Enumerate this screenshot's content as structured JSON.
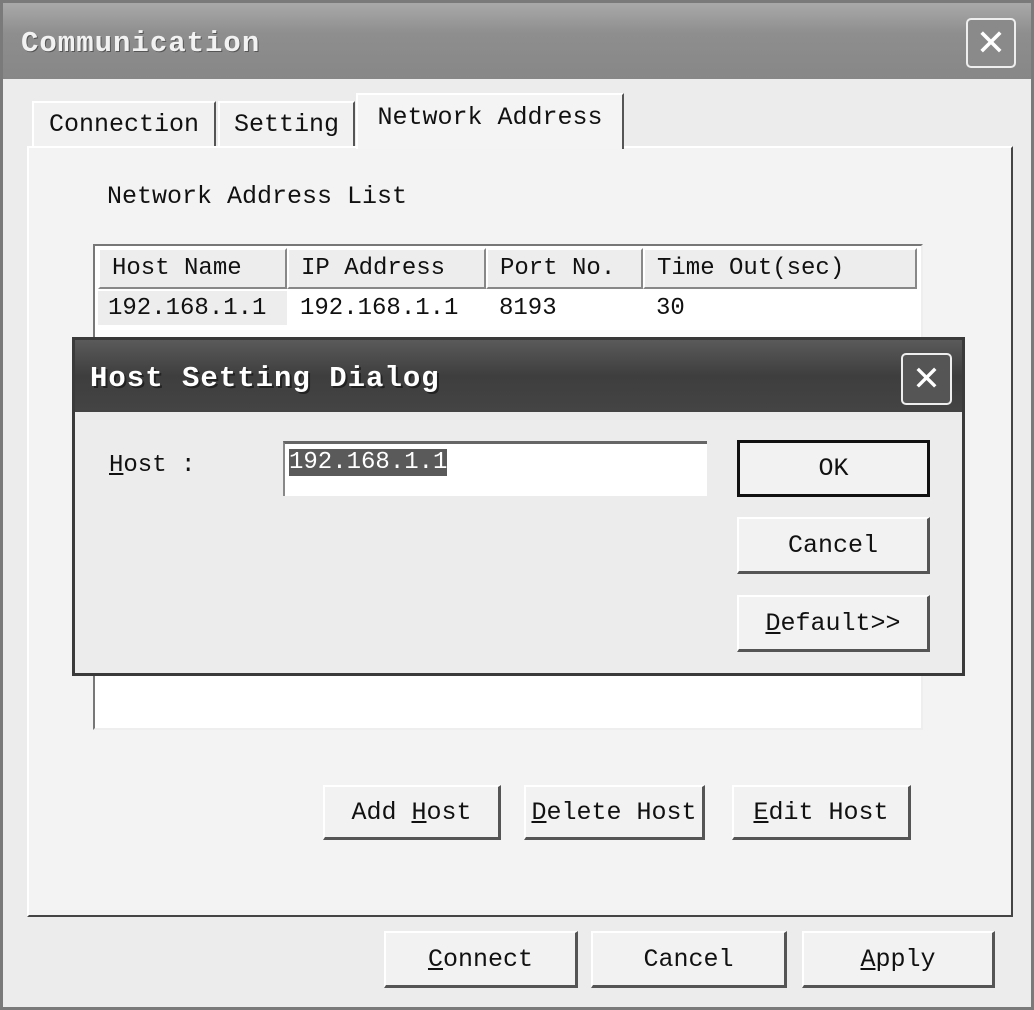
{
  "window": {
    "title": "Communication",
    "close_icon": "close-icon"
  },
  "tabs": [
    {
      "label": "Connection"
    },
    {
      "label": "Setting"
    },
    {
      "label": "Network Address",
      "active": true
    }
  ],
  "panel": {
    "section_label": "Network Address List",
    "columns": [
      "Host Name",
      "IP Address",
      "Port No.",
      "Time Out(sec)"
    ],
    "rows": [
      {
        "host_name": "192.168.1.1",
        "ip": "192.168.1.1",
        "port": "8193",
        "timeout": "30"
      }
    ],
    "buttons": [
      {
        "label": "Add Host",
        "mnemonic": "H"
      },
      {
        "label": "Delete Host",
        "mnemonic": "D"
      },
      {
        "label": "Edit Host",
        "mnemonic": "E"
      }
    ]
  },
  "footer": {
    "buttons": [
      {
        "label": "Connect",
        "mnemonic": "C"
      },
      {
        "label": "Cancel"
      },
      {
        "label": "Apply",
        "mnemonic": "A"
      }
    ]
  },
  "dialog": {
    "title": "Host Setting Dialog",
    "host_label": "Host :",
    "host_mnemonic": "H",
    "host_value": "192.168.1.1",
    "ok": "OK",
    "cancel": "Cancel",
    "default": "Default>>",
    "default_mnemonic": "D"
  }
}
